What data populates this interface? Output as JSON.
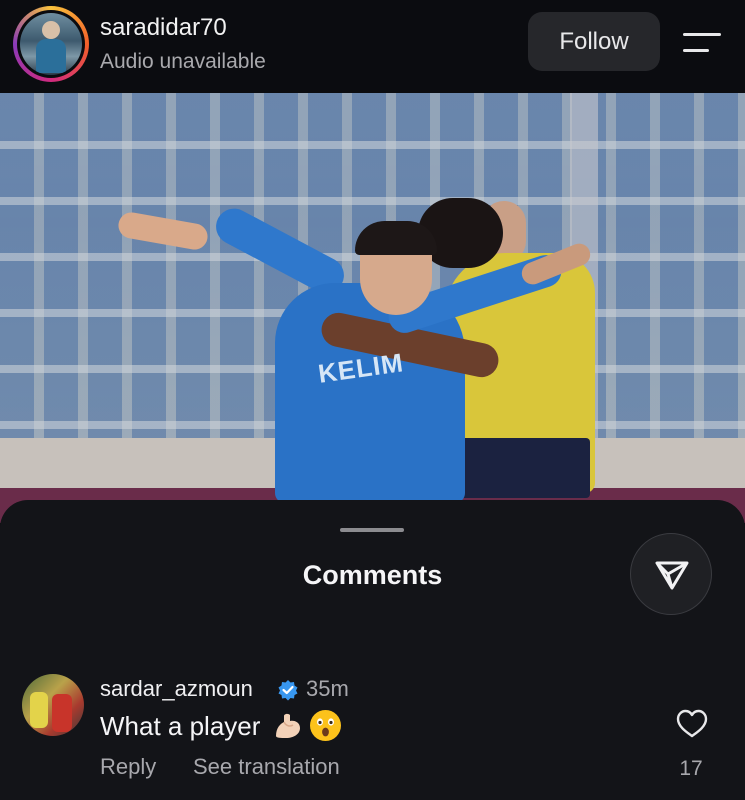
{
  "header": {
    "username": "saradidar70",
    "audio_status": "Audio unavailable",
    "follow_label": "Follow"
  },
  "photo": {
    "jersey_text": "KELIM"
  },
  "comments_sheet": {
    "title": "Comments",
    "comments": [
      {
        "username": "sardar_azmoun",
        "verified": true,
        "time": "35m",
        "text": "What a player",
        "emojis": [
          "flexed-biceps",
          "astonished-face"
        ],
        "reply_label": "Reply",
        "translate_label": "See translation",
        "like_count": "17"
      }
    ]
  },
  "colors": {
    "background": "#0b0c10",
    "sheet": "#131418",
    "verified_blue": "#3897f0",
    "muted_text": "#a8a8ad"
  }
}
